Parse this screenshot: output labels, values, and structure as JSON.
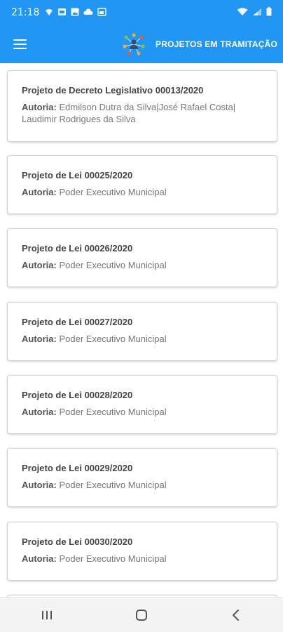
{
  "status_bar": {
    "time": "21:18",
    "left_icons": [
      "wifi-calling-icon",
      "notification-icon",
      "image-icon",
      "cloud-icon",
      "cast-icon"
    ],
    "right_icons": [
      "wifi-icon",
      "signal-icon",
      "battery-icon"
    ]
  },
  "app_bar": {
    "title": "PROJETOS EM TRAMITAÇÃO",
    "accent": "#2196f3"
  },
  "projects": [
    {
      "title": "Projeto de Decreto Legislativo 00013/2020",
      "author_label": "Autoria:",
      "author": "Edmilson Dutra da Silva|José Rafael Costa| Laudimir Rodrigues da Silva"
    },
    {
      "title": "Projeto de Lei 00025/2020",
      "author_label": "Autoria:",
      "author": "Poder Executivo Municipal"
    },
    {
      "title": "Projeto de Lei 00026/2020",
      "author_label": "Autoria:",
      "author": "Poder Executivo Municipal"
    },
    {
      "title": "Projeto de Lei 00027/2020",
      "author_label": "Autoria:",
      "author": "Poder Executivo Municipal"
    },
    {
      "title": "Projeto de Lei 00028/2020",
      "author_label": "Autoria:",
      "author": "Poder Executivo Municipal"
    },
    {
      "title": "Projeto de Lei 00029/2020",
      "author_label": "Autoria:",
      "author": "Poder Executivo Municipal"
    },
    {
      "title": "Projeto de Lei 00030/2020",
      "author_label": "Autoria:",
      "author": "Poder Executivo Municipal"
    }
  ],
  "nav_bar": {
    "buttons": [
      "recent-apps-icon",
      "home-icon",
      "back-icon"
    ]
  }
}
